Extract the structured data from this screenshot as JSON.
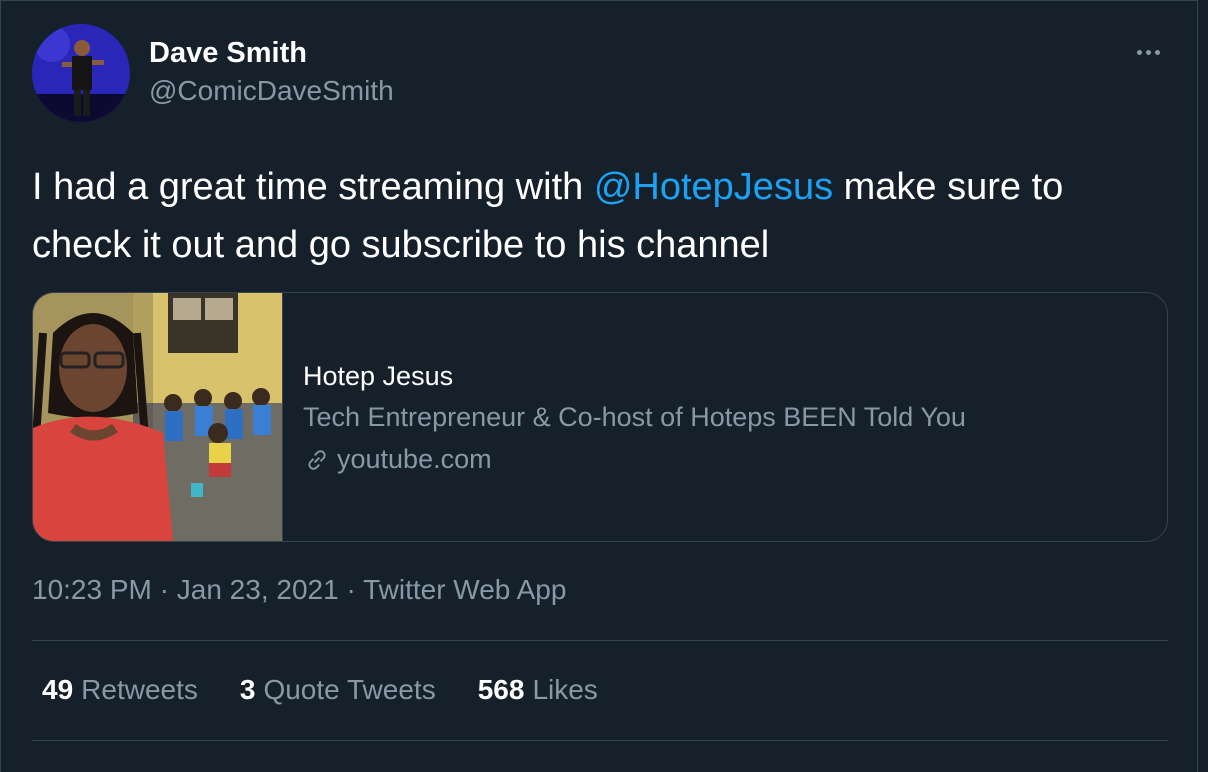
{
  "author": {
    "display_name": "Dave Smith",
    "handle": "@ComicDaveSmith",
    "avatar_icon": "avatar-photo"
  },
  "tweet": {
    "text_before": "I had a great time streaming with ",
    "mention": "@HotepJesus",
    "text_after": " make sure to check it out and go subscribe to his channel"
  },
  "card": {
    "title": "Hotep Jesus",
    "description": "Tech Entrepreneur & Co-host of Hoteps BEEN Told You",
    "domain": "youtube.com",
    "domain_icon": "link-icon"
  },
  "meta": {
    "time": "10:23 PM",
    "date": "Jan 23, 2021",
    "source": "Twitter Web App",
    "separator": "·"
  },
  "stats": [
    {
      "count": "49",
      "label": "Retweets"
    },
    {
      "count": "3",
      "label": "Quote Tweets"
    },
    {
      "count": "568",
      "label": "Likes"
    }
  ],
  "colors": {
    "background": "#15202b",
    "text": "#ffffff",
    "secondary": "#8899a6",
    "accent": "#1da1f2",
    "border": "#38444d"
  },
  "more_icon": "more-horizontal-icon"
}
